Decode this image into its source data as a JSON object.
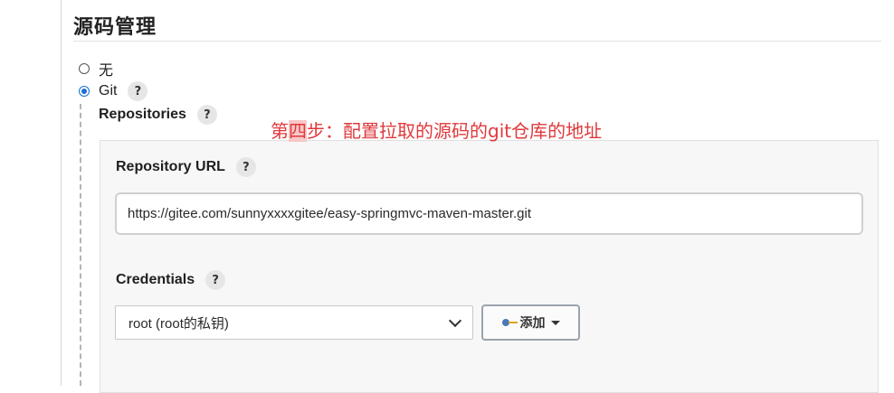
{
  "section": {
    "title": "源码管理"
  },
  "scm_options": [
    {
      "label": "无",
      "selected": false
    },
    {
      "label": "Git",
      "selected": true
    }
  ],
  "help_glyph": "?",
  "repositories": {
    "label": "Repositories"
  },
  "annotation": {
    "highlighted": "四",
    "prefix": "第",
    "suffix": "步：配置拉取的源码的git仓库的地址",
    "color": "#e0393c"
  },
  "repo_url": {
    "label": "Repository URL",
    "value": "https://gitee.com/sunnyxxxxgitee/easy-springmvc-maven-master.git"
  },
  "credentials": {
    "label": "Credentials",
    "selected": "root (root的私钥)",
    "add_label": "添加"
  },
  "colors": {
    "accent": "#1a6fd6",
    "panel_bg": "#f7f7f7"
  }
}
